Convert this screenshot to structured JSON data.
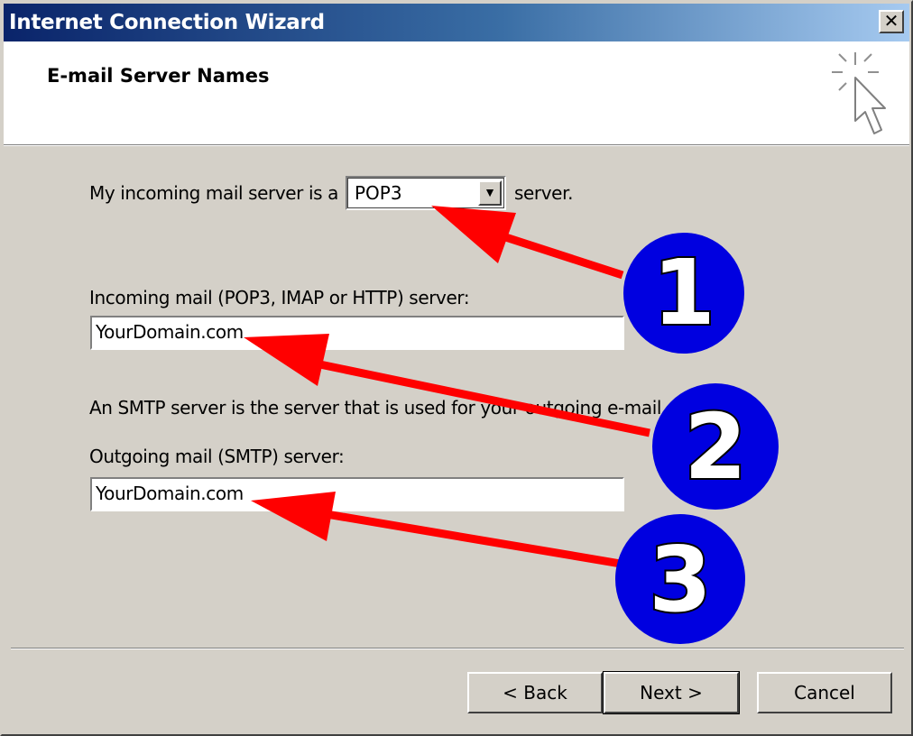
{
  "window": {
    "title": "Internet Connection Wizard",
    "close_glyph": "✕"
  },
  "header": {
    "heading": "E-mail Server Names",
    "icon": "wizard-sparkle-cursor-icon"
  },
  "form": {
    "incoming_type_prefix": "My incoming mail server is a",
    "incoming_type_value": "POP3",
    "incoming_type_suffix": "server.",
    "incoming_label": "Incoming mail (POP3, IMAP or HTTP) server:",
    "incoming_value": "YourDomain.com",
    "smtp_note": "An SMTP server is the server that is used for your outgoing e-mail.",
    "outgoing_label": "Outgoing mail (SMTP) server:",
    "outgoing_value": "YourDomain.com"
  },
  "buttons": {
    "back": "< Back",
    "next": "Next >",
    "cancel": "Cancel"
  },
  "annotations": {
    "markers": [
      "1",
      "2",
      "3"
    ],
    "marker_color": "#0000e0",
    "arrow_color": "#ff0000"
  }
}
